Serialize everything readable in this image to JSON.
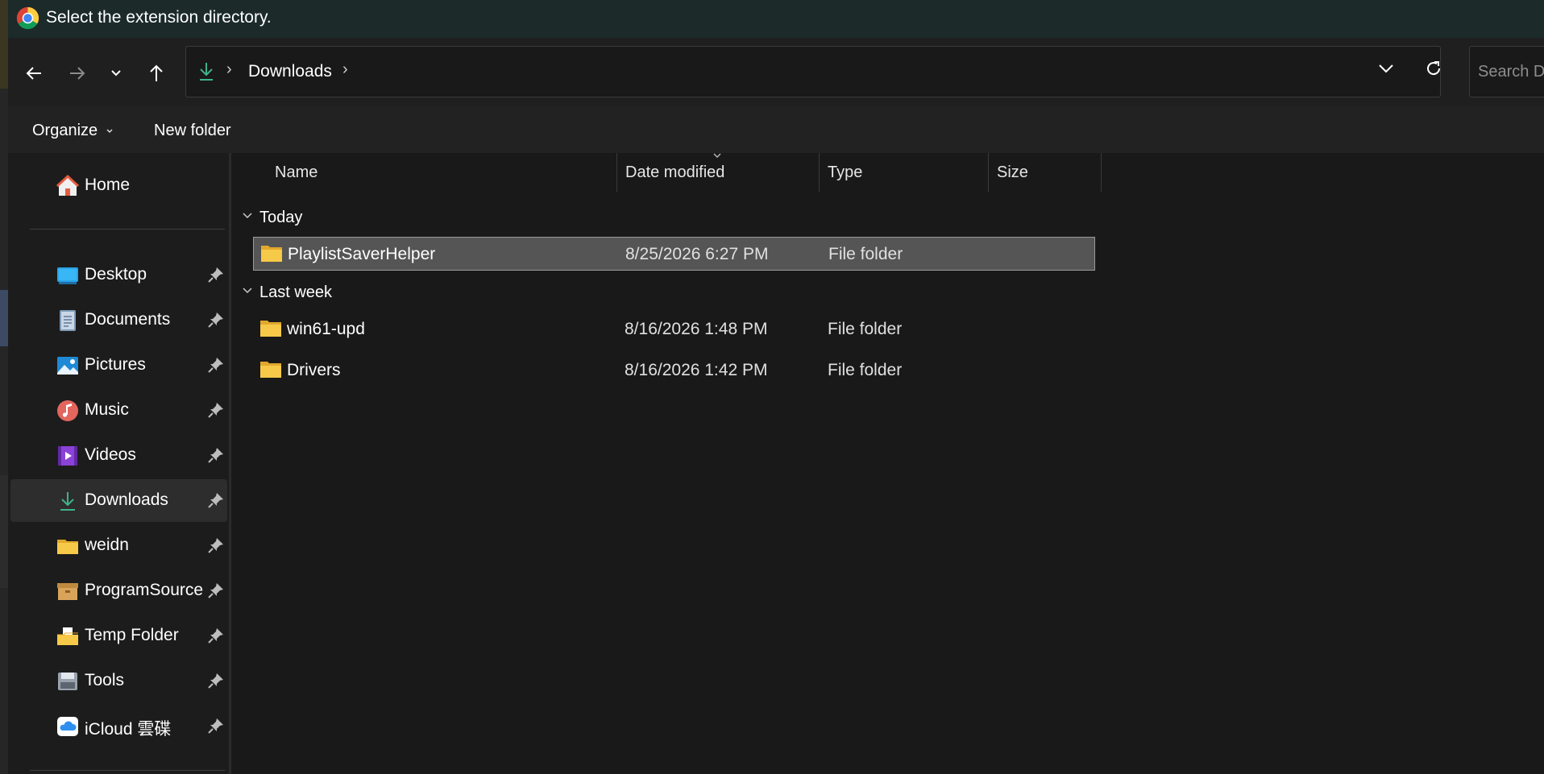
{
  "window": {
    "title": "Select the extension directory.",
    "app_icon": "chrome-icon"
  },
  "nav": {
    "back_icon": "arrow-left-icon",
    "forward_icon": "arrow-right-icon",
    "recent_icon": "chevron-down-icon",
    "up_icon": "arrow-up-icon"
  },
  "address_bar": {
    "location_icon": "download-icon",
    "breadcrumb": [
      "Downloads"
    ],
    "dropdown_icon": "chevron-down-icon",
    "refresh_icon": "refresh-icon"
  },
  "search": {
    "placeholder": "Search Downloads"
  },
  "command_bar": {
    "organize_label": "Organize",
    "new_folder_label": "New folder"
  },
  "sidebar": {
    "home": {
      "label": "Home",
      "icon": "home-icon"
    },
    "quick_access": [
      {
        "label": "Desktop",
        "icon": "desktop-icon",
        "pinned": true
      },
      {
        "label": "Documents",
        "icon": "documents-icon",
        "pinned": true
      },
      {
        "label": "Pictures",
        "icon": "pictures-icon",
        "pinned": true
      },
      {
        "label": "Music",
        "icon": "music-icon",
        "pinned": true
      },
      {
        "label": "Videos",
        "icon": "videos-icon",
        "pinned": true
      },
      {
        "label": "Downloads",
        "icon": "download-icon",
        "pinned": true,
        "selected": true
      },
      {
        "label": "weidn",
        "icon": "folder-icon",
        "pinned": true
      },
      {
        "label": "ProgramSource",
        "icon": "archive-folder-icon",
        "pinned": true
      },
      {
        "label": "Temp Folder",
        "icon": "folder-doc-icon",
        "pinned": true
      },
      {
        "label": "Tools",
        "icon": "disk-icon",
        "pinned": true
      },
      {
        "label": "iCloud 雲碟",
        "icon": "icloud-icon",
        "pinned": true
      }
    ]
  },
  "columns": {
    "name": "Name",
    "date_modified": "Date modified",
    "type": "Type",
    "size": "Size",
    "sorted_column": "date_modified"
  },
  "groups": [
    {
      "label": "Today",
      "items": [
        {
          "name": "PlaylistSaverHelper",
          "date": "8/25/2026 6:27 PM",
          "type": "File folder",
          "size": "",
          "selected": true
        }
      ]
    },
    {
      "label": "Last week",
      "items": [
        {
          "name": "win61-upd",
          "date": "8/16/2026 1:48 PM",
          "type": "File folder",
          "size": ""
        },
        {
          "name": "Drivers",
          "date": "8/16/2026 1:42 PM",
          "type": "File folder",
          "size": ""
        }
      ]
    }
  ],
  "colors": {
    "accent_download": "#3fb28c",
    "folder_yellow": "#f3c23c",
    "selection_bg": "#555555"
  }
}
